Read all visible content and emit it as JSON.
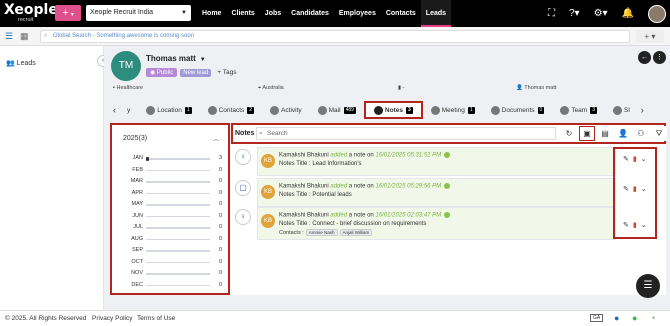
{
  "topbar": {
    "logo_text": "Xeople",
    "logo_sub": "recruit",
    "plus_label": "+",
    "org_select": "Xeople Recruit India",
    "nav": [
      "Home",
      "Clients",
      "Jobs",
      "Candidates",
      "Employees",
      "Contacts",
      "Leads"
    ],
    "active_nav": "Leads"
  },
  "subbar": {
    "search_label": "Global Search",
    "search_placeholder": "Global Search - Something awesome is coming soon",
    "plus_label": "+"
  },
  "sidebar": {
    "leads_label": "Leads"
  },
  "profile": {
    "initials": "TM",
    "name": "Thomas matt",
    "public_label": "Public",
    "status_label": "New lead",
    "add_tags_label": "Tags",
    "industry": "Healthcare",
    "location": "Australia",
    "owner": "Thomas matt",
    "field3": "-"
  },
  "tabs": [
    {
      "label": "y",
      "count": ""
    },
    {
      "label": "Location",
      "count": "1"
    },
    {
      "label": "Contacts",
      "count": "2"
    },
    {
      "label": "Activity",
      "count": ""
    },
    {
      "label": "Mail",
      "count": "489"
    },
    {
      "label": "Notes",
      "count": "3",
      "active": true
    },
    {
      "label": "Meeting",
      "count": "1"
    },
    {
      "label": "Documents",
      "count": "0"
    },
    {
      "label": "Team",
      "count": "3"
    },
    {
      "label": "Sl",
      "count": ""
    }
  ],
  "calendar": {
    "year_label": "2025(3)",
    "months": [
      {
        "m": "JAN",
        "v": "3",
        "frac": 0.0
      },
      {
        "m": "FEB",
        "v": "0",
        "frac": 0.0
      },
      {
        "m": "MAR",
        "v": "0",
        "frac": 0.0
      },
      {
        "m": "APR",
        "v": "0",
        "frac": 0.0
      },
      {
        "m": "MAY",
        "v": "0",
        "frac": 0.0
      },
      {
        "m": "JUN",
        "v": "0",
        "frac": 0.0
      },
      {
        "m": "JUL",
        "v": "0",
        "frac": 0.0
      },
      {
        "m": "AUG",
        "v": "0",
        "frac": 0.0
      },
      {
        "m": "SEP",
        "v": "0",
        "frac": 0.0
      },
      {
        "m": "OCT",
        "v": "0",
        "frac": 0.0
      },
      {
        "m": "NOV",
        "v": "0",
        "frac": 0.0
      },
      {
        "m": "DEC",
        "v": "0",
        "frac": 0.0
      }
    ]
  },
  "notes": {
    "title": "Notes",
    "search_placeholder": "Search",
    "items": [
      {
        "initials": "KB",
        "author": "Kamakshi Bhakuni",
        "verb": "added",
        "text": "a note on",
        "datetime": "16/01/2025 05:31:52 PM",
        "title_label": "Notes Title :",
        "title_value": "Lead Information's"
      },
      {
        "initials": "KB",
        "author": "Kamakshi Bhakuni",
        "verb": "added",
        "text": "a note on",
        "datetime": "16/01/2025 05:29:56 PM",
        "title_label": "Notes Title :",
        "title_value": "Potential leads"
      },
      {
        "initials": "KB",
        "author": "Kamakshi Bhakuni",
        "verb": "added",
        "text": "a note on",
        "datetime": "16/01/2025 02:03:47 PM",
        "title_label": "Notes Title :",
        "title_value": "Connect - brief discussion on requirements",
        "contacts_label": "Contacts :",
        "contacts": [
          "Ammie Nash",
          "Anjali William"
        ]
      }
    ]
  },
  "footer": {
    "copyright": "© 2025. All Rights Reserved",
    "privacy": "Privacy Policy",
    "terms": "Terms of Use",
    "ga": "GA"
  }
}
